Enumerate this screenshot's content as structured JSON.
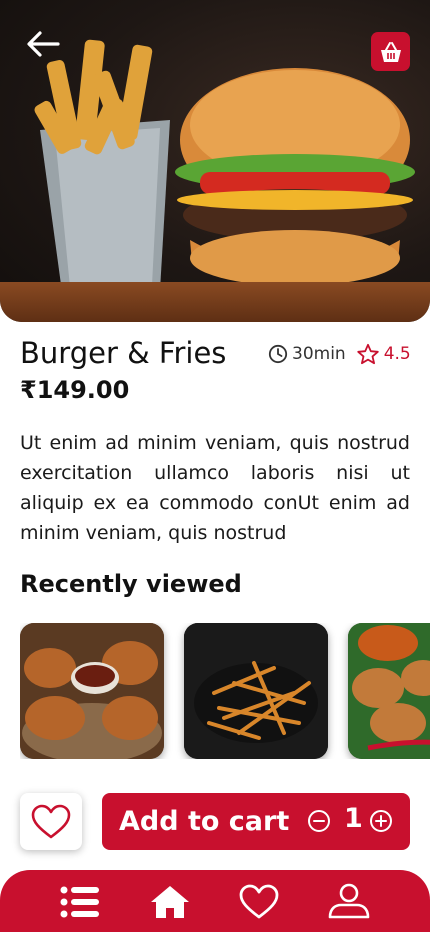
{
  "product": {
    "name": "Burger & Fries",
    "price": "₹149.00",
    "time": "30min",
    "rating": "4.5",
    "description": "Ut enim ad minim veniam, quis nostrud exercitation ullamco laboris nisi ut aliquip ex ea commodo conUt enim ad minim veniam, quis nostrud"
  },
  "recently_viewed": {
    "title": "Recently viewed",
    "items": [
      {
        "icon": "fried-chicken-image"
      },
      {
        "icon": "fries-image"
      },
      {
        "icon": "chicken-pakora-image"
      }
    ]
  },
  "cart": {
    "label": "Add to cart",
    "quantity": "1"
  },
  "nav": {
    "items": [
      "menu-icon",
      "home-icon",
      "heart-icon",
      "profile-icon"
    ]
  },
  "colors": {
    "accent": "#c8102e"
  }
}
